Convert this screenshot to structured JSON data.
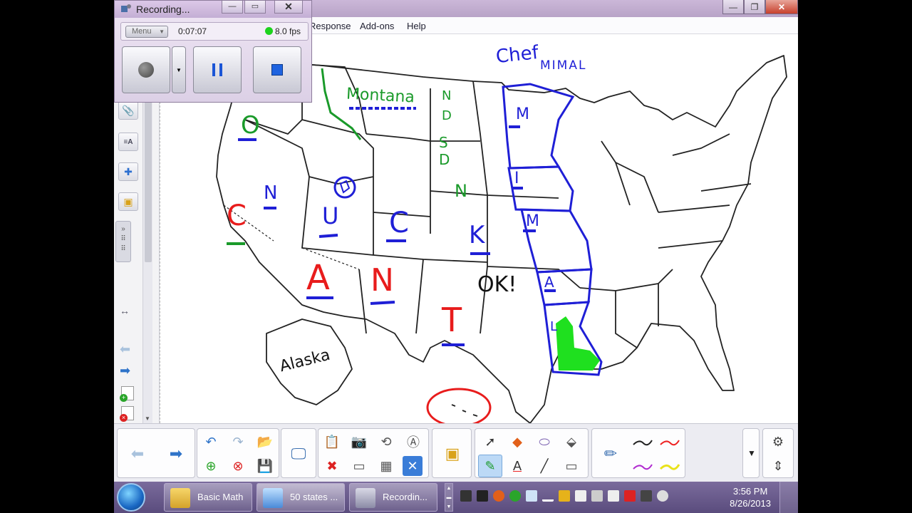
{
  "recorder": {
    "title": "Recording...",
    "menu_label": "Menu",
    "elapsed": "0:07:07",
    "fps": "8.0 fps"
  },
  "app": {
    "menus": [
      "Response",
      "Add-ons",
      "Help"
    ]
  },
  "map": {
    "handwriting": {
      "title_a": "Chef",
      "title_b": "MIMAL",
      "montana": "Montana",
      "nd_n": "N",
      "nd_d": "D",
      "sd_s": "S",
      "sd_d": "D",
      "oregon": "O",
      "nevada": "N",
      "california": "C",
      "utah": "U",
      "colorado": "C",
      "nebraska": "N",
      "kansas": "K",
      "arizona": "A",
      "new_mexico": "N",
      "oklahoma": "OK!",
      "texas": "T",
      "alaska": "Alaska",
      "mn": "M",
      "ia": "I",
      "mo": "M",
      "ar": "A",
      "la": "L",
      "side_mark": "⫶"
    }
  },
  "taskbar": {
    "items": [
      "Basic Math",
      "50 states ...",
      "Recordin..."
    ],
    "time": "3:56 PM",
    "date": "8/26/2013"
  },
  "colors": {
    "blue_ink": "#1f1fd6",
    "green_ink": "#1a9a2a",
    "red_ink": "#e81c1c",
    "highlight_green": "#1fe01f"
  }
}
